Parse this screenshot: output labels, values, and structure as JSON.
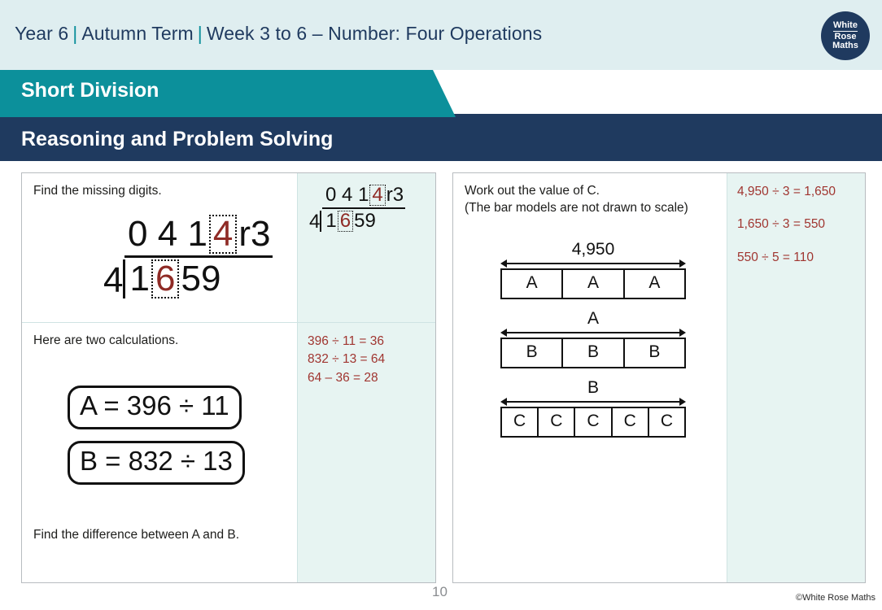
{
  "header": {
    "year": "Year 6",
    "term": "Autumn Term",
    "week": "Week 3 to 6 – Number: Four Operations",
    "separator": "|",
    "logo": {
      "line1": "White",
      "line2": "Rose",
      "line3": "Maths"
    }
  },
  "banner": {
    "topic": "Short Division",
    "section": "Reasoning and Problem Solving"
  },
  "questions": {
    "q1": {
      "prompt": "Find the missing digits.",
      "quotient": {
        "d1": "0",
        "d2": "4",
        "d3": "1",
        "missing": "4",
        "remainder": "r3"
      },
      "divisor": "4",
      "dividend": {
        "d1": "1",
        "missing": "6",
        "d3": "5",
        "d4": "9"
      },
      "answer_quotient": {
        "d1": "0",
        "d2": "4",
        "d3": "1",
        "missing": "4",
        "remainder": "r3"
      },
      "answer_divisor": "4",
      "answer_dividend": {
        "d1": "1",
        "missing": "6",
        "d3": "5",
        "d4": "9"
      }
    },
    "q2": {
      "prompt": "Here are two calculations.",
      "calc_a": "A = 396 ÷ 11",
      "calc_b": "B = 832 ÷ 13",
      "follow_up": "Find the difference between A and B.",
      "answers": [
        "396 ÷ 11 = 36",
        "832 ÷ 13 = 64",
        "64 – 36 = 28"
      ]
    },
    "q3": {
      "prompt_line1": "Work out the value of C.",
      "prompt_line2": "(The bar models are not drawn to scale)",
      "bar_models": [
        {
          "total_label": "4,950",
          "part_label": "A",
          "parts": 3
        },
        {
          "total_label": "A",
          "part_label": "B",
          "parts": 3
        },
        {
          "total_label": "B",
          "part_label": "C",
          "parts": 5
        }
      ],
      "answers": [
        "4,950 ÷ 3 = 1,650",
        "1,650 ÷ 3 = 550",
        "550 ÷ 5 = 110"
      ]
    }
  },
  "footer": {
    "page_number": "10",
    "copyright": "©White Rose Maths"
  },
  "colors": {
    "header_bg": "#dfeef0",
    "navy": "#1f3a5f",
    "teal": "#0c909b",
    "answer_text": "#a03530",
    "answer_bg": "#e7f4f2"
  }
}
